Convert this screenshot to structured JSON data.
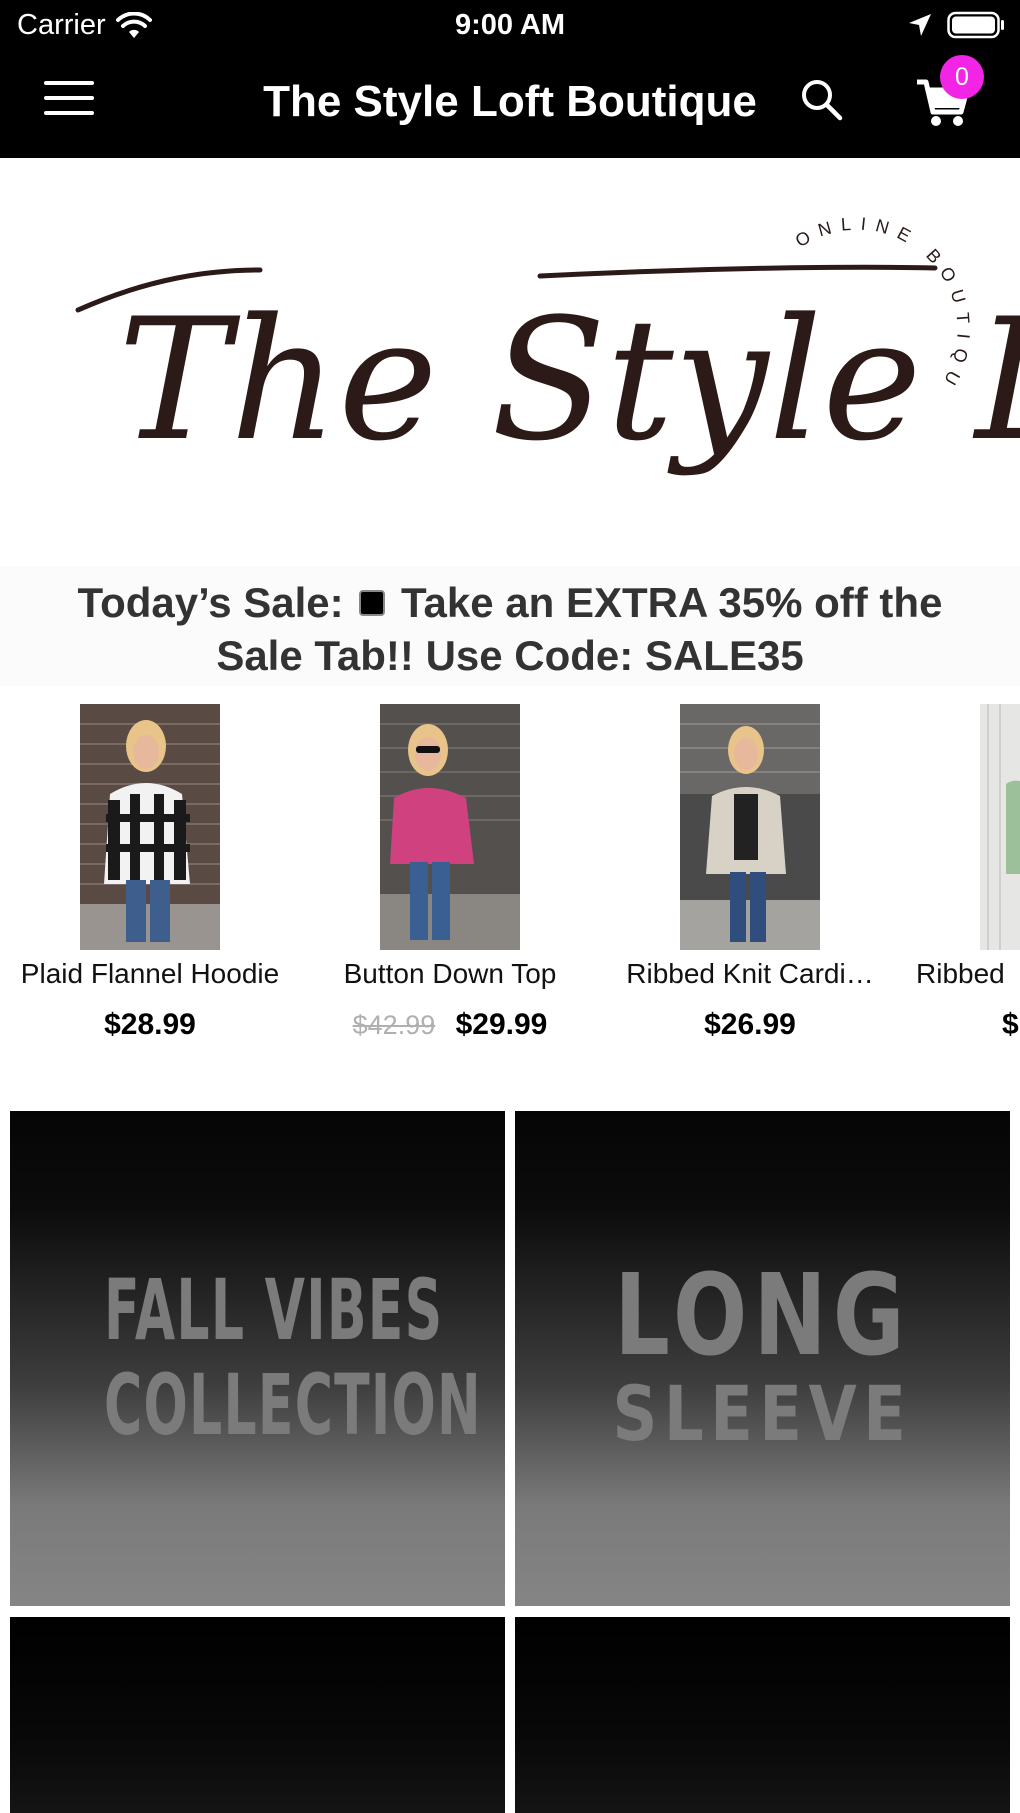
{
  "status_bar": {
    "carrier": "Carrier",
    "time": "9:00 AM"
  },
  "nav": {
    "title": "The Style Loft Boutique",
    "cart_count": "0",
    "icons": [
      "menu-icon",
      "search-icon",
      "cart-icon"
    ]
  },
  "logo": {
    "main_text": "The Style Loft",
    "arc_text": "ONLINE BOUTIQUE"
  },
  "sale_banner": {
    "line1_prefix": "Today’s Sale:",
    "line1_suffix": "Take an EXTRA 35% off the",
    "line2": "Sale Tab!! Use Code: SALE35"
  },
  "products": [
    {
      "name": "Plaid Flannel Hoodie",
      "price": "$28.99",
      "old_price": ""
    },
    {
      "name": "Button Down Top",
      "price": "$29.99",
      "old_price": "$42.99"
    },
    {
      "name": "Ribbed Knit Cardi…",
      "price": "$26.99",
      "old_price": ""
    },
    {
      "name": "Ribbed",
      "price": "$",
      "old_price": ""
    }
  ],
  "categories": [
    {
      "line1": "FALL VIBES",
      "line2": "COLLECTION"
    },
    {
      "line1": "LONG",
      "line2": "SLEEVE"
    }
  ],
  "colors": {
    "header_bg": "#000000",
    "badge": "#f224e6",
    "logo_ink": "#2b1a17",
    "tile_text": "#7b7b7b"
  }
}
